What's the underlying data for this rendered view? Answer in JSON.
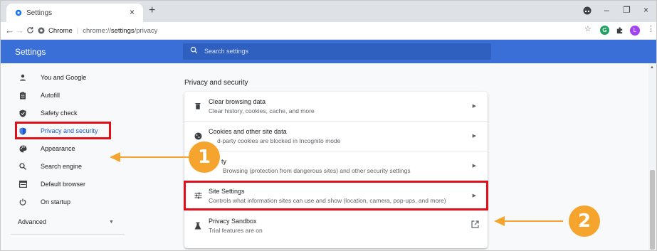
{
  "tab": {
    "title": "Settings",
    "close": "×",
    "new_tab": "+"
  },
  "window": {
    "minimize": "–",
    "restore": "❐",
    "close": "×"
  },
  "address": {
    "site_label": "Chrome",
    "scheme": "chrome://",
    "path_bold": "settings",
    "path_rest": "/privacy"
  },
  "profile": {
    "initial": "L",
    "ext_initial": "G"
  },
  "header": {
    "title": "Settings",
    "search_placeholder": "Search settings"
  },
  "sidebar": {
    "items": [
      {
        "label": "You and Google",
        "icon": "person-icon"
      },
      {
        "label": "Autofill",
        "icon": "clipboard-icon"
      },
      {
        "label": "Safety check",
        "icon": "shield-check-icon"
      },
      {
        "label": "Privacy and security",
        "icon": "shield-icon"
      },
      {
        "label": "Appearance",
        "icon": "palette-icon"
      },
      {
        "label": "Search engine",
        "icon": "search-icon"
      },
      {
        "label": "Default browser",
        "icon": "browser-icon"
      },
      {
        "label": "On startup",
        "icon": "power-icon"
      }
    ],
    "advanced": "Advanced"
  },
  "main": {
    "section_title": "Privacy and security",
    "rows": [
      {
        "title": "Clear browsing data",
        "subtitle": "Clear history, cookies, cache, and more",
        "icon": "trash-icon"
      },
      {
        "title": "Cookies and other site data",
        "subtitle": "d-party cookies are blocked in Incognito mode",
        "icon": "cookie-icon"
      },
      {
        "title": "ty",
        "subtitle": "Browsing (protection from dangerous sites) and other security settings",
        "icon": "security-icon"
      },
      {
        "title": "Site Settings",
        "subtitle": "Controls what information sites can use and show (location, camera, pop-ups, and more)",
        "icon": "sliders-icon"
      },
      {
        "title": "Privacy Sandbox",
        "subtitle": "Trial features are on",
        "icon": "flask-icon"
      }
    ]
  },
  "annotations": {
    "badge1": "1",
    "badge2": "2"
  },
  "colors": {
    "header_blue": "#3a6fd8",
    "highlight_red": "#e0101a",
    "badge_orange": "#f5a42d",
    "active_blue": "#1a56c8"
  }
}
